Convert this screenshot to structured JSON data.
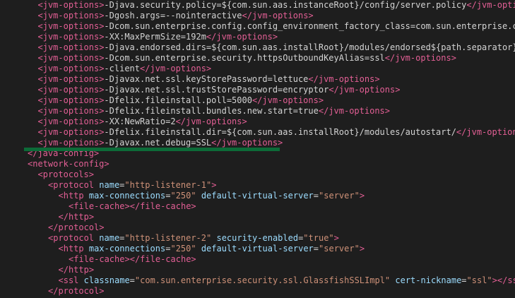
{
  "lines": [
    {
      "indent": 3,
      "text": "-Djava.security.policy=${com.sun.aas.instanceRoot}/config/server.policy"
    },
    {
      "indent": 3,
      "text": "-Dgosh.args=--nointeractive"
    },
    {
      "indent": 3,
      "text": "-Dcom.sun.enterprise.config.config_environment_factory_class=com.sun.enterprise.config"
    },
    {
      "indent": 3,
      "text": "-XX:MaxPermSize=192m"
    },
    {
      "indent": 3,
      "text": "-Djava.endorsed.dirs=${com.sun.aas.installRoot}/modules/endorsed${path.separator}${com"
    },
    {
      "indent": 3,
      "text": "-Dcom.sun.enterprise.security.httpsOutboundKeyAlias=ssl"
    },
    {
      "indent": 3,
      "text": "-client"
    },
    {
      "indent": 3,
      "text": "-Djavax.net.ssl.keyStorePassword=lettuce"
    },
    {
      "indent": 3,
      "text": "-Djavax.net.ssl.trustStorePassword=encryptor"
    },
    {
      "indent": 3,
      "text": "-Dfelix.fileinstall.poll=5000"
    },
    {
      "indent": 3,
      "text": "-Dfelix.fileinstall.bundles.new.start=true"
    },
    {
      "indent": 3,
      "text": "-XX:NewRatio=2"
    },
    {
      "indent": 3,
      "text": "-Dfelix.fileinstall.dir=${com.sun.aas.installRoot}/modules/autostart/"
    },
    {
      "indent": 3,
      "text": "-Djavax.net.debug=SSL"
    },
    {
      "indent": 2,
      "close": "java-config"
    },
    {
      "indent": 2,
      "open": "network-config"
    },
    {
      "indent": 3,
      "open": "protocols"
    },
    {
      "indent": 4,
      "open": "protocol",
      "attrs": [
        {
          "name": "name",
          "value": "\"http-listener-1\""
        }
      ]
    },
    {
      "indent": 5,
      "open": "http",
      "attrs": [
        {
          "name": "max-connections",
          "value": "\"250\""
        },
        {
          "name": "default-virtual-server",
          "value": "\"server\""
        }
      ]
    },
    {
      "indent": 6,
      "open": "file-cache",
      "close": "file-cache"
    },
    {
      "indent": 5,
      "close": "http"
    },
    {
      "indent": 4,
      "close": "protocol"
    },
    {
      "indent": 4,
      "open": "protocol",
      "attrs": [
        {
          "name": "name",
          "value": "\"http-listener-2\""
        },
        {
          "name": "security-enabled",
          "value": "\"true\""
        }
      ]
    },
    {
      "indent": 5,
      "open": "http",
      "attrs": [
        {
          "name": "max-connections",
          "value": "\"250\""
        },
        {
          "name": "default-virtual-server",
          "value": "\"server\""
        }
      ]
    },
    {
      "indent": 6,
      "open": "file-cache",
      "close": "file-cache"
    },
    {
      "indent": 5,
      "close": "http"
    },
    {
      "indent": 5,
      "open": "ssl",
      "attrs": [
        {
          "name": "classname",
          "value": "\"com.sun.enterprise.security.ssl.GlassfishSSLImpl\""
        },
        {
          "name": "cert-nickname",
          "value": "\"ssl\""
        }
      ],
      "close": "ssl"
    },
    {
      "indent": 4,
      "close": "protocol"
    }
  ],
  "jvm_tag": "jvm-options",
  "colors": {
    "background": "#1e1e1e",
    "tag": "#e35f95",
    "text": "#d4d4d4",
    "attribute": "#9cdcfe",
    "value": "#ce9178",
    "highlight_underline": "#0c6b38"
  }
}
